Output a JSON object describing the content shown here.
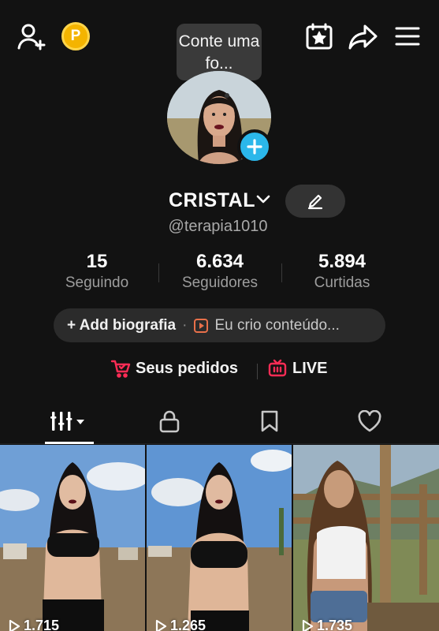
{
  "header": {
    "icons": [
      "add-friend-icon",
      "coin-icon",
      "calendar-star-icon",
      "share-icon",
      "menu-icon"
    ],
    "coin_letter": "P",
    "tooltip": "Conte uma fo..."
  },
  "profile": {
    "display_name": "CRISTAL",
    "username": "@terapia1010",
    "avatar_add_icon": "plus-icon"
  },
  "stats": [
    {
      "value": "15",
      "label": "Seguindo"
    },
    {
      "value": "6.634",
      "label": "Seguidores"
    },
    {
      "value": "5.894",
      "label": "Curtidas"
    }
  ],
  "bio": {
    "add_label": "+ Add biografia",
    "separator": "·",
    "creator_label": "Eu crio conteúdo..."
  },
  "links": {
    "orders": "Seus pedidos",
    "live": "LIVE"
  },
  "tabs": [
    "videos-grid-icon",
    "lock-icon",
    "bookmark-icon",
    "heart-icon"
  ],
  "videos": [
    {
      "views": "1.715"
    },
    {
      "views": "1.265"
    },
    {
      "views": "1.735"
    }
  ],
  "colors": {
    "background": "#121212",
    "accent_blue": "#2bb7ea",
    "coin": "#f4b400",
    "shop_red": "#fe2c55"
  }
}
